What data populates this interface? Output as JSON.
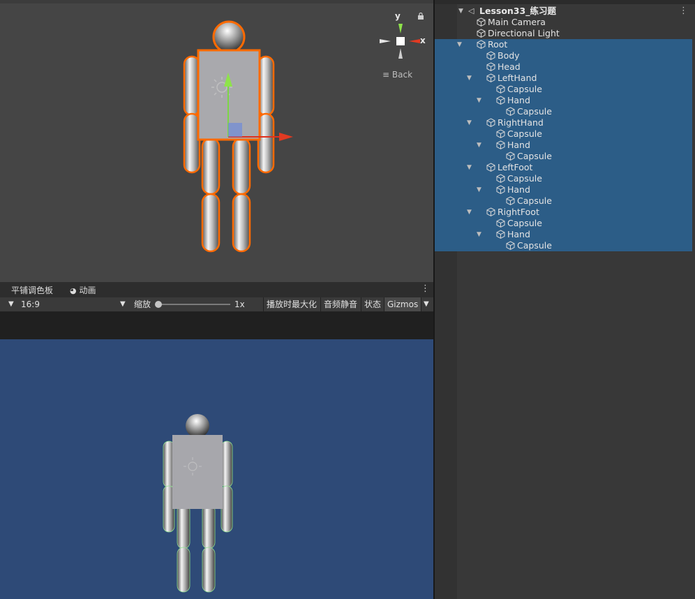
{
  "scene_view": {
    "axis_y_label": "y",
    "axis_x_label": "x",
    "back_label": "Back",
    "icons": [
      "lock-icon",
      "scene-gizmo-icon",
      "hamburger-icon"
    ]
  },
  "game_panel": {
    "tabs": [
      {
        "label": "平铺调色板"
      },
      {
        "label": "动画",
        "icon": "clock-icon"
      }
    ],
    "toolbar": {
      "aspect": "16:9",
      "scale_label": "缩放",
      "scale_value": "1x",
      "maximize_label": "播放时最大化",
      "mute_label": "音频静音",
      "stats_label": "状态",
      "gizmos_label": "Gizmos"
    },
    "background_color": "#2e4a77"
  },
  "hierarchy": {
    "scene_name": "Lesson33_练习题",
    "items": [
      {
        "label": "Main Camera",
        "depth": 1,
        "expanded": null
      },
      {
        "label": "Directional Light",
        "depth": 1,
        "expanded": null
      },
      {
        "label": "Root",
        "depth": 1,
        "expanded": true
      },
      {
        "label": "Body",
        "depth": 2,
        "expanded": null
      },
      {
        "label": "Head",
        "depth": 2,
        "expanded": null
      },
      {
        "label": "LeftHand",
        "depth": 2,
        "expanded": true
      },
      {
        "label": "Capsule",
        "depth": 3,
        "expanded": null
      },
      {
        "label": "Hand",
        "depth": 3,
        "expanded": true
      },
      {
        "label": "Capsule",
        "depth": 4,
        "expanded": null
      },
      {
        "label": "RightHand",
        "depth": 2,
        "expanded": true
      },
      {
        "label": "Capsule",
        "depth": 3,
        "expanded": null
      },
      {
        "label": "Hand",
        "depth": 3,
        "expanded": true
      },
      {
        "label": "Capsule",
        "depth": 4,
        "expanded": null
      },
      {
        "label": "LeftFoot",
        "depth": 2,
        "expanded": true
      },
      {
        "label": "Capsule",
        "depth": 3,
        "expanded": null
      },
      {
        "label": "Hand",
        "depth": 3,
        "expanded": true
      },
      {
        "label": "Capsule",
        "depth": 4,
        "expanded": null
      },
      {
        "label": "RightFoot",
        "depth": 2,
        "expanded": true
      },
      {
        "label": "Capsule",
        "depth": 3,
        "expanded": null
      },
      {
        "label": "Hand",
        "depth": 3,
        "expanded": true
      },
      {
        "label": "Capsule",
        "depth": 4,
        "expanded": null
      }
    ],
    "selection_color": "#2c5d87"
  }
}
